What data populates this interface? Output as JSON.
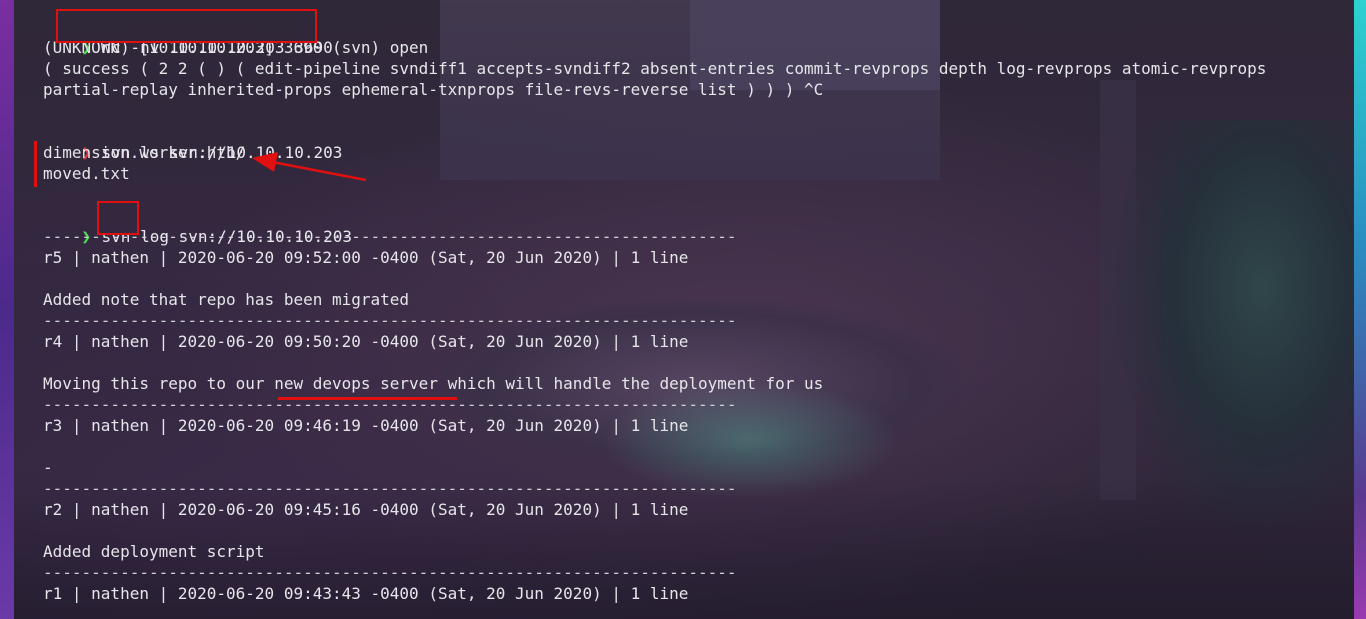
{
  "colors": {
    "prompt_success": "#4fe04f",
    "prompt_error": "#e83a3a",
    "annotation": "#e01010",
    "text": "#e6e6ea"
  },
  "icons": {
    "prompt": "chevron-right-icon",
    "annotation_arrow": "arrow-left-icon"
  },
  "terminal": {
    "prompt_glyph": "❯",
    "cmd_nc": "nc -nv 10.10.10.203 3690",
    "nc_out_1": "(UNKNOWN) [10.10.10.203] 3690 (svn) open",
    "nc_out_2": "( success ( 2 2 ( ) ( edit-pipeline svndiff1 accepts-svndiff2 absent-entries commit-revprops depth log-revprops atomic-revprops",
    "nc_out_3": "partial-replay inherited-props ephemeral-txnprops file-revs-reverse list ) ) ) ^C",
    "cmd_ls": "svn ls svn://10.10.10.203",
    "ls_out_1": "dimension.worker.htb/",
    "ls_out_2": "moved.txt",
    "cmd_log_svn": "svn",
    "cmd_log_log": "log",
    "cmd_log_url": "svn://10.10.10.203",
    "separator": "------------------------------------------------------------------------",
    "r5": "r5 | nathen | 2020-06-20 09:52:00 -0400 (Sat, 20 Jun 2020) | 1 line",
    "r5_msg": "Added note that repo has been migrated",
    "r4": "r4 | nathen | 2020-06-20 09:50:20 -0400 (Sat, 20 Jun 2020) | 1 line",
    "r4_msg": "Moving this repo to our new devops server which will handle the deployment for us",
    "r3": "r3 | nathen | 2020-06-20 09:46:19 -0400 (Sat, 20 Jun 2020) | 1 line",
    "r3_msg": "-",
    "r2": "r2 | nathen | 2020-06-20 09:45:16 -0400 (Sat, 20 Jun 2020) | 1 line",
    "r2_msg": "Added deployment script",
    "r1": "r1 | nathen | 2020-06-20 09:43:43 -0400 (Sat, 20 Jun 2020) | 1 line"
  }
}
